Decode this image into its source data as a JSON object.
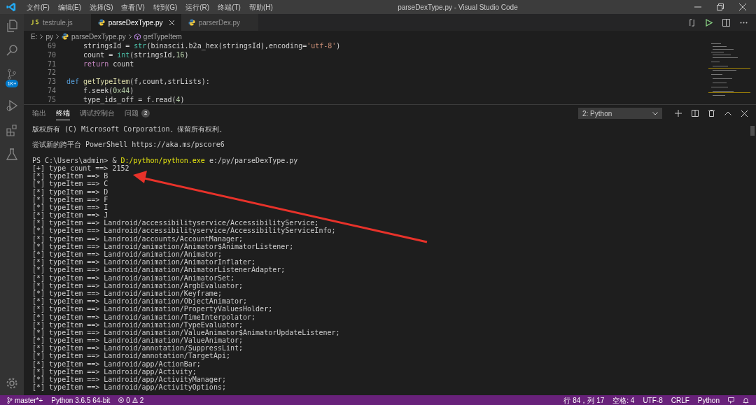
{
  "window": {
    "title": "parseDexType.py - Visual Studio Code"
  },
  "menu": [
    "文件(F)",
    "编辑(E)",
    "选择(S)",
    "查看(V)",
    "转到(G)",
    "运行(R)",
    "终端(T)",
    "帮助(H)"
  ],
  "activity_bar": {
    "badge": "1K+"
  },
  "tabs": [
    {
      "label": "testrule.js",
      "kind": "js",
      "selected": false
    },
    {
      "label": "parseDexType.py",
      "kind": "py",
      "selected": true
    },
    {
      "label": "parserDex.py",
      "kind": "py",
      "selected": false
    }
  ],
  "breadcrumb": {
    "drive": "E:",
    "folder": "py",
    "file": "parseDexType.py",
    "symbol": "getTypeItem"
  },
  "code_lines": [
    {
      "number": "69",
      "tokens": [
        {
          "text": "    stringsId = ",
          "kind": "plain"
        },
        {
          "text": "str",
          "kind": "builtin"
        },
        {
          "text": "(binascii.b2a_hex(stringsId),encoding=",
          "kind": "plain"
        },
        {
          "text": "'utf-8'",
          "kind": "string"
        },
        {
          "text": ")",
          "kind": "plain"
        }
      ]
    },
    {
      "number": "70",
      "tokens": [
        {
          "text": "    count = ",
          "kind": "plain"
        },
        {
          "text": "int",
          "kind": "builtin"
        },
        {
          "text": "(stringsId,",
          "kind": "plain"
        },
        {
          "text": "16",
          "kind": "number"
        },
        {
          "text": ")",
          "kind": "plain"
        }
      ]
    },
    {
      "number": "71",
      "tokens": [
        {
          "text": "    return",
          "kind": "keyword"
        },
        {
          "text": " count",
          "kind": "plain"
        }
      ]
    },
    {
      "number": "72"
    },
    {
      "number": "73",
      "tokens": [
        {
          "text": "def",
          "kind": "def"
        },
        {
          "text": " getTypeItem",
          "kind": "funcname"
        },
        {
          "text": "(f,count,strLists):",
          "kind": "plain"
        }
      ]
    },
    {
      "number": "74",
      "tokens": [
        {
          "text": "    f.seek(",
          "kind": "plain"
        },
        {
          "text": "0x44",
          "kind": "number"
        },
        {
          "text": ")",
          "kind": "plain"
        }
      ]
    },
    {
      "number": "75",
      "tokens": [
        {
          "text": "    type_ids_off = f.read(",
          "kind": "plain"
        },
        {
          "text": "4",
          "kind": "number"
        },
        {
          "text": ")",
          "kind": "plain"
        }
      ]
    }
  ],
  "panel_tabs": [
    {
      "label": "输出",
      "selected": false
    },
    {
      "label": "终端",
      "selected": true
    },
    {
      "label": "调试控制台",
      "selected": false
    },
    {
      "label": "问题",
      "selected": false,
      "badge": "2"
    }
  ],
  "terminal_select": "2: Python",
  "terminal_lines": [
    {
      "kind": "text",
      "text": "版权所有 (C) Microsoft Corporation。保留所有权利。"
    },
    {
      "kind": "blank"
    },
    {
      "kind": "text",
      "text": "尝试新的跨平台 PowerShell https://aka.ms/pscore6"
    },
    {
      "kind": "blank"
    },
    {
      "kind": "command",
      "prompt": "PS C:\\Users\\admin> & ",
      "exe": "D:/python/python.exe",
      "args": " e:/py/parseDexType.py"
    },
    {
      "kind": "text",
      "text": "[+] type count ==> 2152"
    },
    {
      "kind": "text",
      "text": "[*] typeItem ==> B"
    },
    {
      "kind": "text",
      "text": "[*] typeItem ==> C"
    },
    {
      "kind": "text",
      "text": "[*] typeItem ==> D"
    },
    {
      "kind": "text",
      "text": "[*] typeItem ==> F"
    },
    {
      "kind": "text",
      "text": "[*] typeItem ==> I"
    },
    {
      "kind": "text",
      "text": "[*] typeItem ==> J"
    },
    {
      "kind": "text",
      "text": "[*] typeItem ==> Landroid/accessibilityservice/AccessibilityService;"
    },
    {
      "kind": "text",
      "text": "[*] typeItem ==> Landroid/accessibilityservice/AccessibilityServiceInfo;"
    },
    {
      "kind": "text",
      "text": "[*] typeItem ==> Landroid/accounts/AccountManager;"
    },
    {
      "kind": "text",
      "text": "[*] typeItem ==> Landroid/animation/Animator$AnimatorListener;"
    },
    {
      "kind": "text",
      "text": "[*] typeItem ==> Landroid/animation/Animator;"
    },
    {
      "kind": "text",
      "text": "[*] typeItem ==> Landroid/animation/AnimatorInflater;"
    },
    {
      "kind": "text",
      "text": "[*] typeItem ==> Landroid/animation/AnimatorListenerAdapter;"
    },
    {
      "kind": "text",
      "text": "[*] typeItem ==> Landroid/animation/AnimatorSet;"
    },
    {
      "kind": "text",
      "text": "[*] typeItem ==> Landroid/animation/ArgbEvaluator;"
    },
    {
      "kind": "text",
      "text": "[*] typeItem ==> Landroid/animation/Keyframe;"
    },
    {
      "kind": "text",
      "text": "[*] typeItem ==> Landroid/animation/ObjectAnimator;"
    },
    {
      "kind": "text",
      "text": "[*] typeItem ==> Landroid/animation/PropertyValuesHolder;"
    },
    {
      "kind": "text",
      "text": "[*] typeItem ==> Landroid/animation/TimeInterpolator;"
    },
    {
      "kind": "text",
      "text": "[*] typeItem ==> Landroid/animation/TypeEvaluator;"
    },
    {
      "kind": "text",
      "text": "[*] typeItem ==> Landroid/animation/ValueAnimator$AnimatorUpdateListener;"
    },
    {
      "kind": "text",
      "text": "[*] typeItem ==> Landroid/animation/ValueAnimator;"
    },
    {
      "kind": "text",
      "text": "[*] typeItem ==> Landroid/annotation/SuppressLint;"
    },
    {
      "kind": "text",
      "text": "[*] typeItem ==> Landroid/annotation/TargetApi;"
    },
    {
      "kind": "text",
      "text": "[*] typeItem ==> Landroid/app/ActionBar;"
    },
    {
      "kind": "text",
      "text": "[*] typeItem ==> Landroid/app/Activity;"
    },
    {
      "kind": "text",
      "text": "[*] typeItem ==> Landroid/app/ActivityManager;"
    },
    {
      "kind": "text",
      "text": "[*] typeItem ==> Landroid/app/ActivityOptions;"
    }
  ],
  "status_bar": {
    "branch": "master*+",
    "interpreter": "Python 3.6.5 64-bit",
    "errors": "0",
    "warnings": "2",
    "position": "行 84，列 17",
    "indent": "空格: 4",
    "encoding": "UTF-8",
    "eol": "CRLF",
    "language": "Python"
  }
}
